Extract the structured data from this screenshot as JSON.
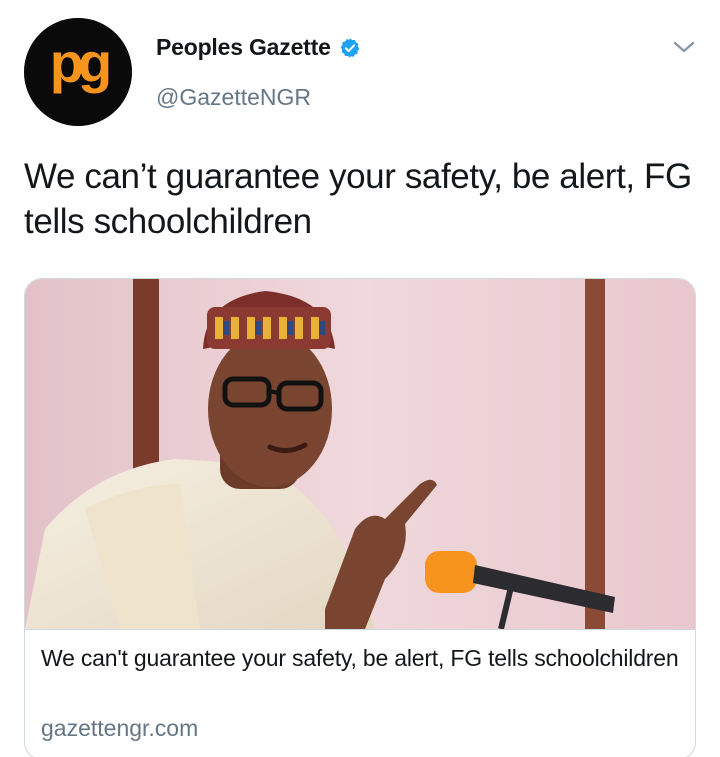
{
  "account": {
    "display_name": "Peoples Gazette",
    "handle": "@GazetteNGR",
    "verified": true,
    "avatar_text": "pg"
  },
  "tweet": {
    "text": "We can’t guarantee your safety, be alert, FG tells schoolchildren"
  },
  "card": {
    "title": "We can't guarantee your safety, be alert, FG tells schoolchildren",
    "domain": "gazettengr.com"
  },
  "colors": {
    "brand_orange": "#f7941d",
    "verified_blue": "#1da1f2",
    "secondary_text": "#657786",
    "border": "#cfd9de"
  },
  "icons": {
    "menu": "chevron-down-icon",
    "verified": "verified-badge-icon"
  }
}
